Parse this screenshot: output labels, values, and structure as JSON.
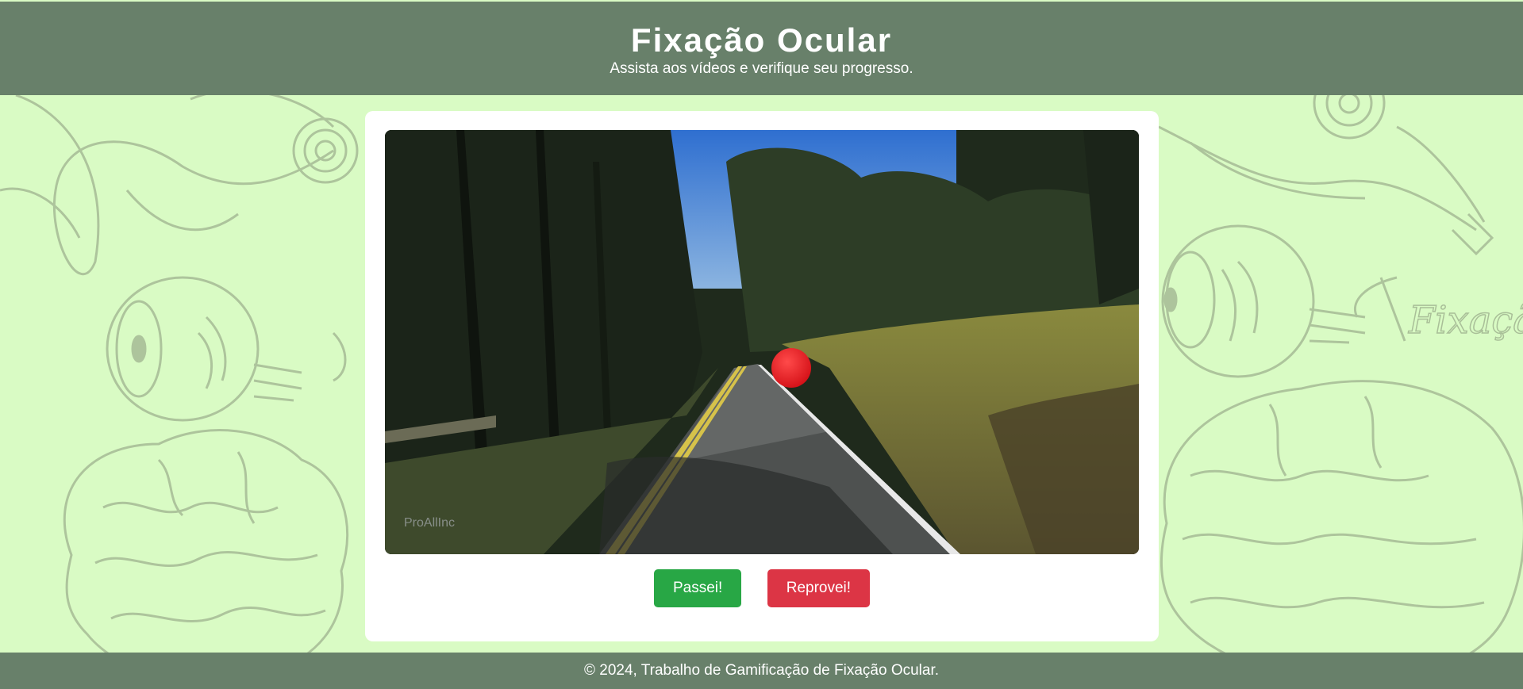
{
  "header": {
    "title": "Fixação Ocular",
    "subtitle": "Assista aos vídeos e verifique seu progresso."
  },
  "video": {
    "watermark": "ProAllInc"
  },
  "actions": {
    "pass_label": "Passei!",
    "fail_label": "Reprovei!"
  },
  "footer": {
    "text": "© 2024, Trabalho de Gamificação de Fixação Ocular."
  },
  "background": {
    "sketch_text": "Fixação"
  },
  "colors": {
    "header_bg": "#68806a",
    "page_bg": "#d9fbc4",
    "sketch": "#a9bf98",
    "pass": "#28a745",
    "fail": "#dc3545",
    "target_dot": "#e8141c"
  },
  "icons": {
    "target": "red-fixation-dot"
  }
}
